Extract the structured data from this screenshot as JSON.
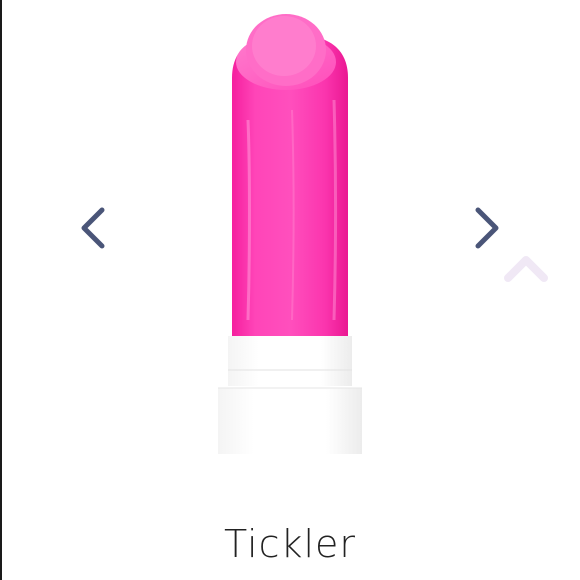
{
  "product": {
    "name": "Tickler",
    "shade_color": "#ff3fb4",
    "cap_color": "#ffffff"
  },
  "carousel": {
    "prev_icon": "chevron-left-icon",
    "next_icon": "chevron-right-icon",
    "arrow_color": "#4a5578"
  },
  "scroll_top": {
    "icon": "chevron-up-icon",
    "color": "#f0e8f5"
  }
}
